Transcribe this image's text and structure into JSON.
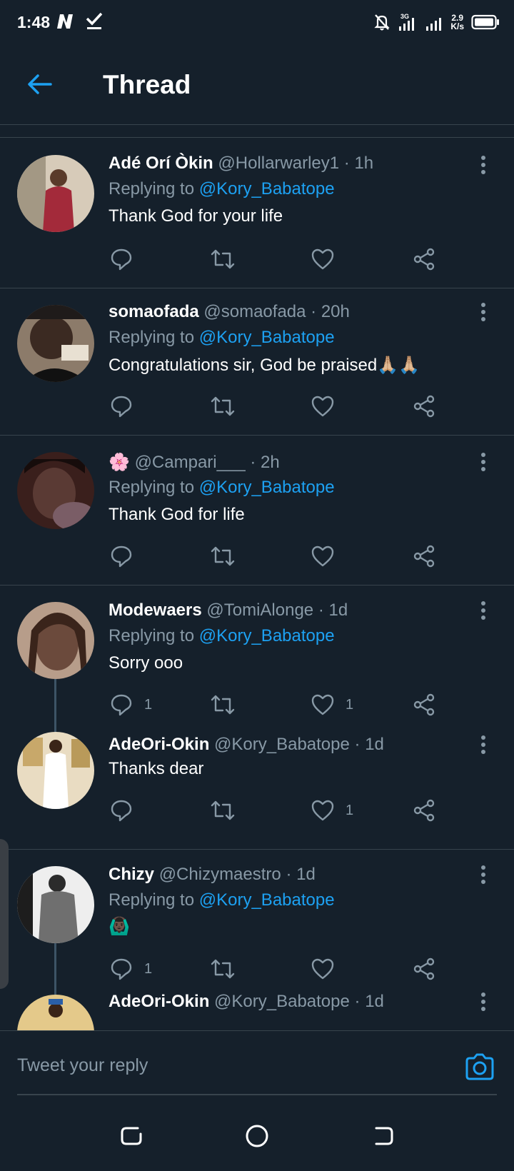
{
  "status_bar": {
    "time": "1:48",
    "net_speed_value": "2.9",
    "net_speed_unit": "K/s",
    "network_type": "3G"
  },
  "header": {
    "title": "Thread"
  },
  "replying_label": "Replying to",
  "tweets": [
    {
      "name": "Adé Orí Òkin",
      "handle": "@Hollarwarley1",
      "time": "· 1h",
      "reply_to": "@Kory_Babatope",
      "text": "Thank God for your life",
      "reply_count": "",
      "like_count": "",
      "avatar_color": "#8a6f5a"
    },
    {
      "name": "somaofada",
      "handle": "@somaofada",
      "time": "· 20h",
      "reply_to": "@Kory_Babatope",
      "text": "Congratulations sir, God be praised🙏🏼🙏🏼",
      "reply_count": "",
      "like_count": "",
      "avatar_color": "#3b2a22"
    },
    {
      "name": "🌸",
      "handle": "@Campari___",
      "time": "· 2h",
      "reply_to": "@Kory_Babatope",
      "text": "Thank God for life",
      "reply_count": "",
      "like_count": "",
      "avatar_color": "#5a3a34"
    },
    {
      "name": "Modewaers",
      "handle": "@TomiAlonge",
      "time": "· 1d",
      "reply_to": "@Kory_Babatope",
      "text": "Sorry ooo",
      "reply_count": "1",
      "like_count": "1",
      "avatar_color": "#6b4a3c"
    },
    {
      "name": "AdeOri-Okin",
      "handle": "@Kory_Babatope",
      "time": "· 1d",
      "reply_to": "",
      "text": "Thanks dear",
      "reply_count": "",
      "like_count": "1",
      "avatar_color": "#c9b89a"
    },
    {
      "name": "Chizy",
      "handle": "@Chizymaestro",
      "time": "· 1d",
      "reply_to": "@Kory_Babatope",
      "text": "🙆🏿‍♂️",
      "reply_count": "1",
      "like_count": "",
      "avatar_color": "#d8d8d8"
    },
    {
      "name": "AdeOri-Okin",
      "handle": "@Kory_Babatope",
      "time": "· 1d",
      "reply_to": "",
      "text": "",
      "reply_count": "",
      "like_count": "",
      "avatar_color": "#c9a470"
    }
  ],
  "composer": {
    "placeholder": "Tweet your reply"
  },
  "colors": {
    "background": "#15202b",
    "accent": "#1da1f2",
    "muted": "#8899a6",
    "divider": "#38444d"
  }
}
